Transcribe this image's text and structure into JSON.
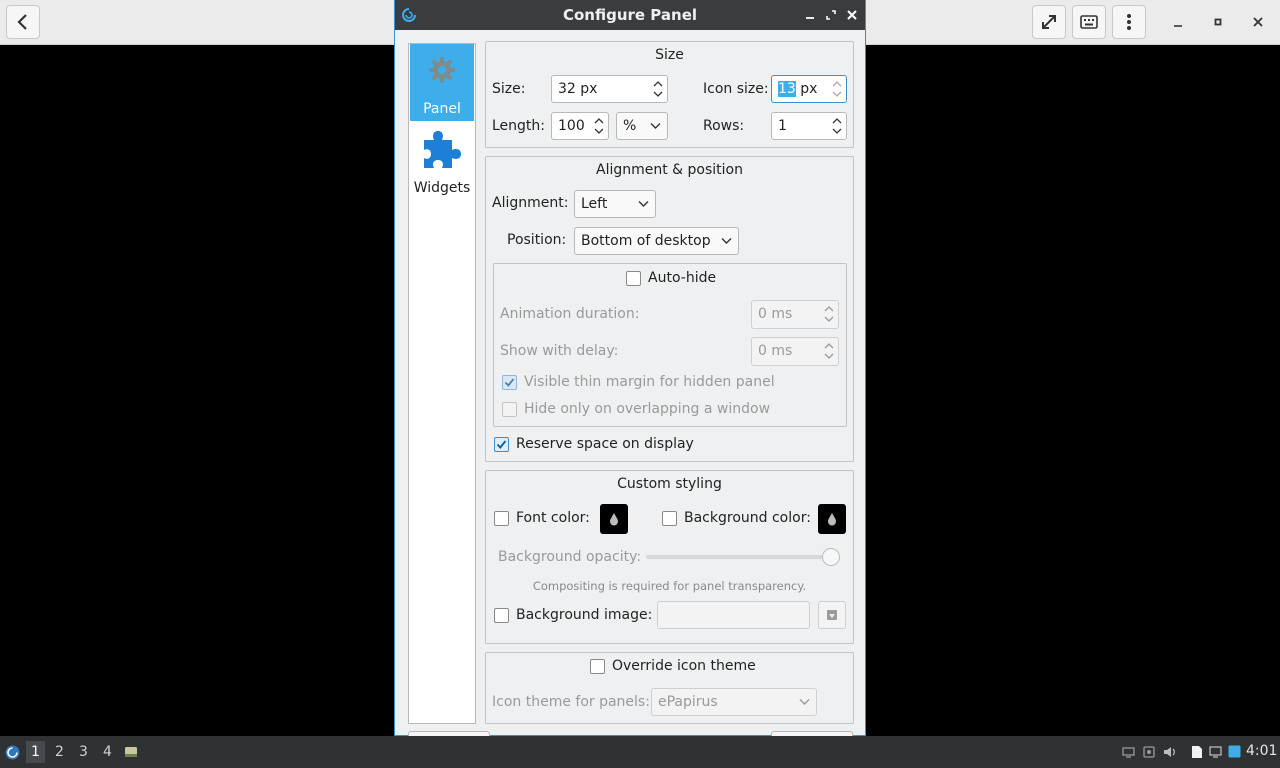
{
  "dialog": {
    "title": "Configure Panel",
    "sidebar": [
      {
        "label": "Panel",
        "icon": "gear-icon",
        "active": true
      },
      {
        "label": "Widgets",
        "icon": "puzzle-icon",
        "active": false
      }
    ],
    "size_group": {
      "title": "Size",
      "size_label": "Size:",
      "size_value": "32 px",
      "icon_size_label": "Icon size:",
      "icon_size_value": "13",
      "icon_size_unit": " px",
      "length_label": "Length:",
      "length_value": "100",
      "length_unit": "%",
      "rows_label": "Rows:",
      "rows_value": "1"
    },
    "alignment_group": {
      "title": "Alignment & position",
      "alignment_label": "Alignment:",
      "alignment_value": "Left",
      "position_label": "Position:",
      "position_value": "Bottom of desktop",
      "autohide_label": "Auto-hide",
      "animation_label": "Animation duration:",
      "animation_value": "0 ms",
      "delay_label": "Show with delay:",
      "delay_value": "0 ms",
      "thin_margin_label": "Visible thin margin for hidden panel",
      "overlap_label": "Hide only on overlapping a window",
      "reserve_label": "Reserve space on display"
    },
    "styling_group": {
      "title": "Custom styling",
      "font_color_label": "Font color:",
      "bg_color_label": "Background color:",
      "bg_opacity_label": "Background opacity:",
      "compositing_hint": "Compositing is required for panel transparency.",
      "bg_image_label": "Background image:",
      "bg_image_value": ""
    },
    "icon_theme_group": {
      "override_label": "Override icon theme",
      "theme_label": "Icon theme for panels:",
      "theme_value": "ePapirus"
    }
  },
  "taskbar": {
    "workspaces": [
      "1",
      "2",
      "3",
      "4"
    ],
    "active_workspace": "1",
    "clock": "4:01"
  },
  "colors": {
    "accent": "#3daee9",
    "titlebar": "#3a3c40",
    "taskbar": "#2f3133",
    "dialog_bg": "#eff0f1"
  }
}
